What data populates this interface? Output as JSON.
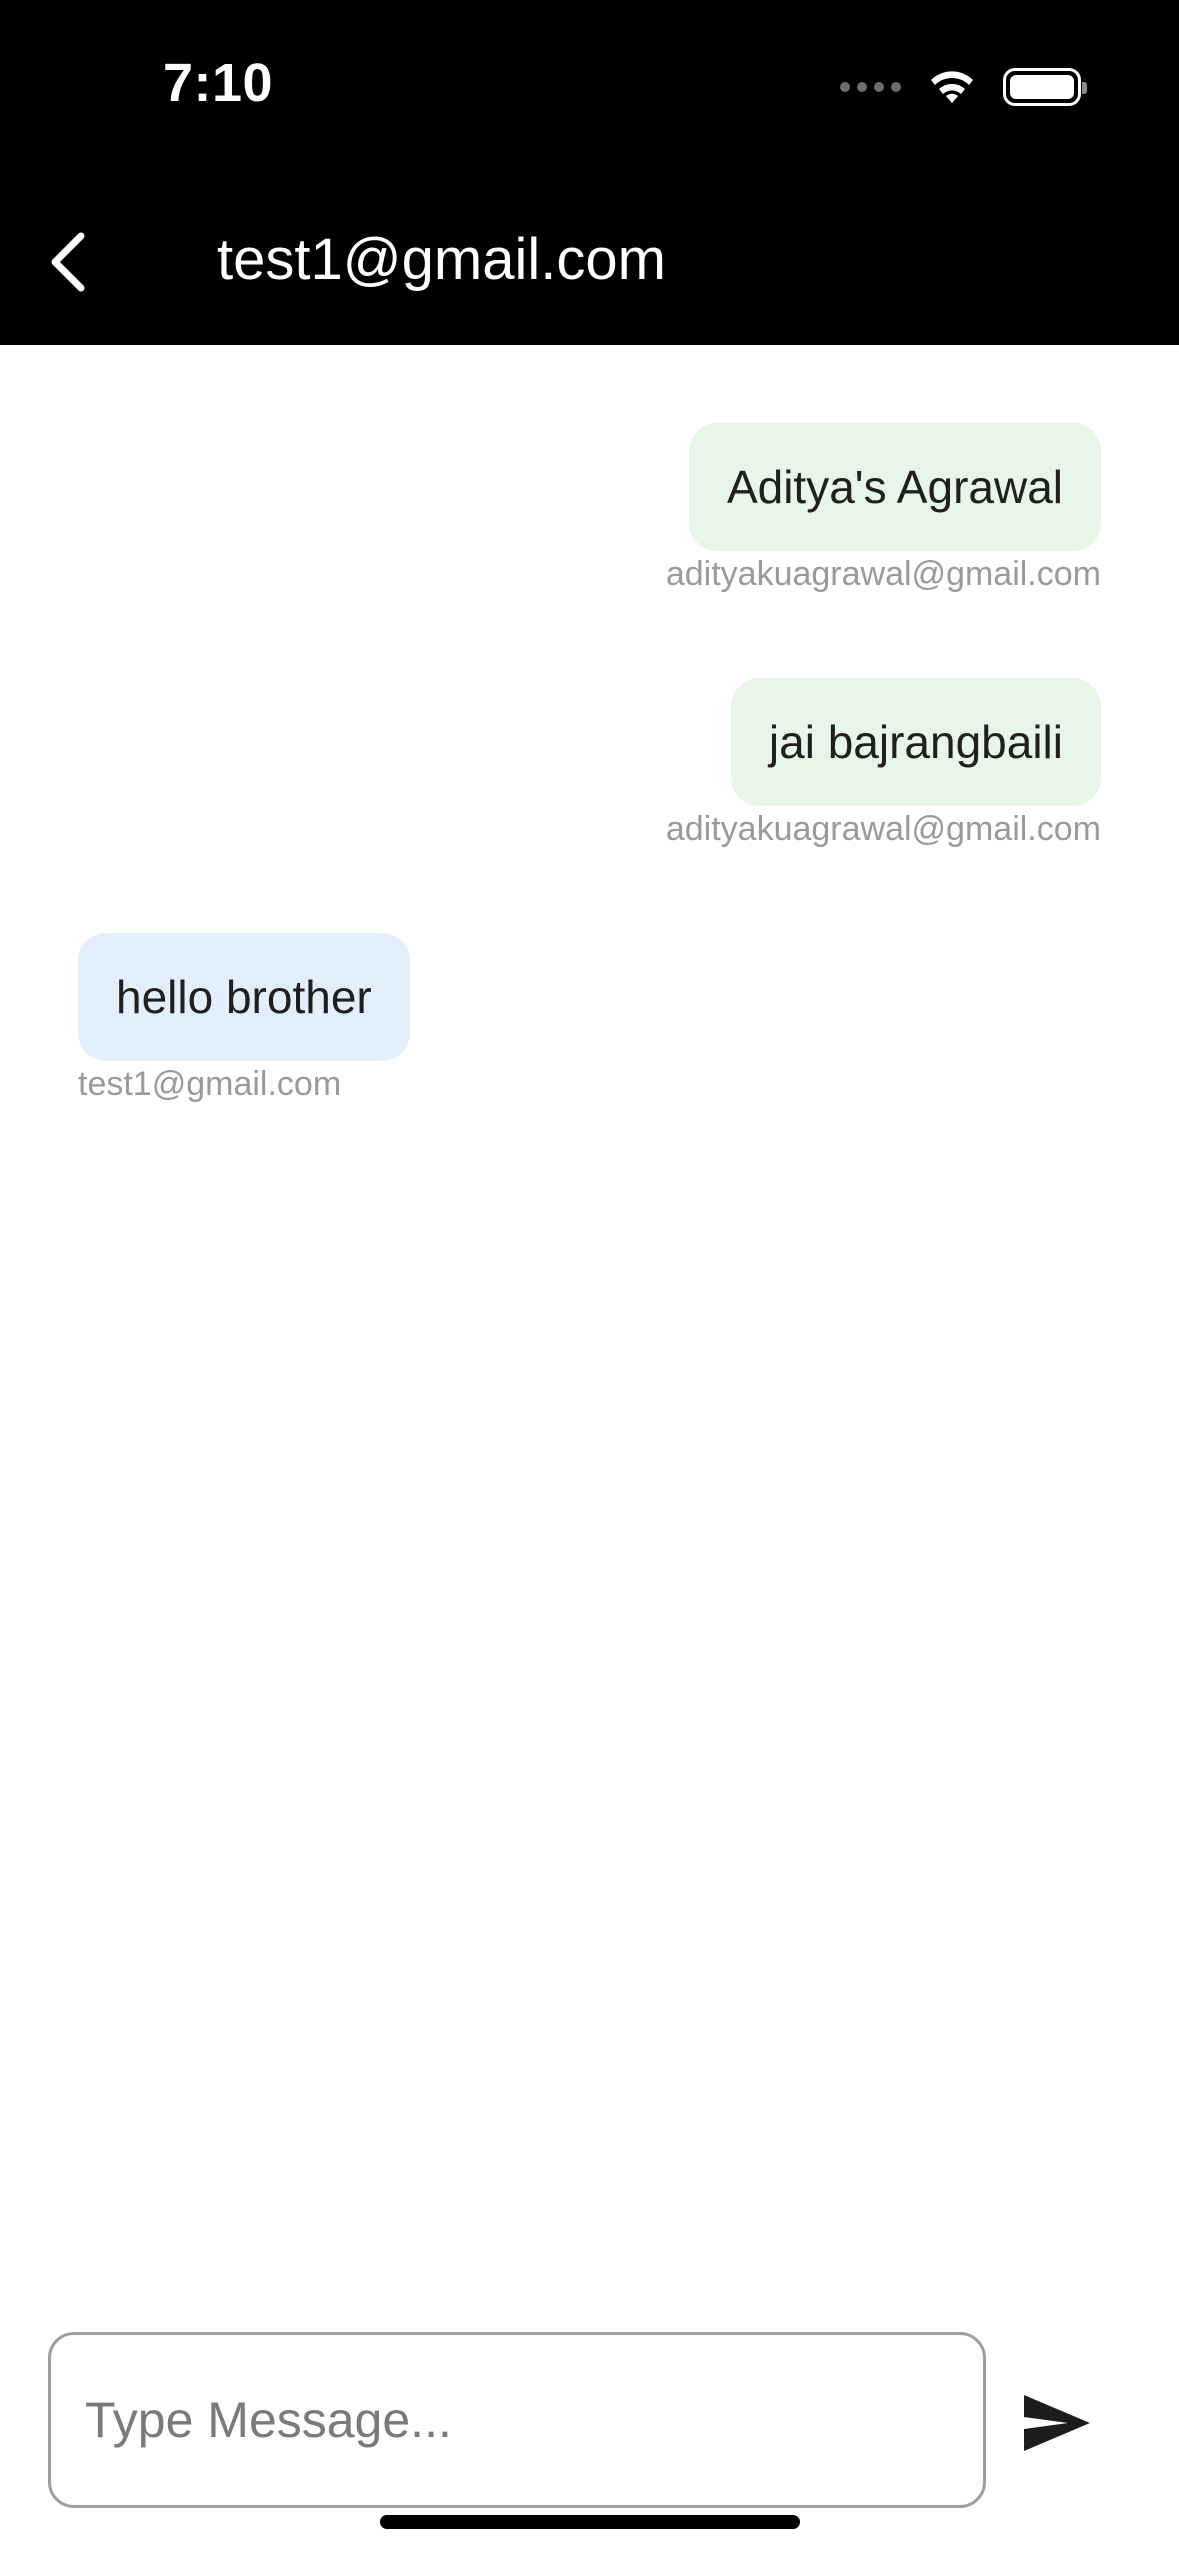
{
  "status_bar": {
    "time": "7:10",
    "icons": [
      "cellular-signal-icon",
      "wifi-icon",
      "battery-icon"
    ]
  },
  "header": {
    "back_icon": "chevron-left-icon",
    "title": "test1@gmail.com"
  },
  "messages": [
    {
      "text": "Aditya's Agrawal",
      "sender": "adityakuagrawal@gmail.com",
      "side": "right"
    },
    {
      "text": "jai bajrangbaili",
      "sender": "adityakuagrawal@gmail.com",
      "side": "right"
    },
    {
      "text": "hello brother",
      "sender": "test1@gmail.com",
      "side": "left"
    }
  ],
  "composer": {
    "placeholder": "Type Message...",
    "value": "",
    "send_icon": "send-icon"
  },
  "colors": {
    "header_bg": "#000000",
    "own_bubble": "#e8f5e9",
    "other_bubble": "#e3f0fc",
    "sender_text": "#9a9a9a"
  }
}
